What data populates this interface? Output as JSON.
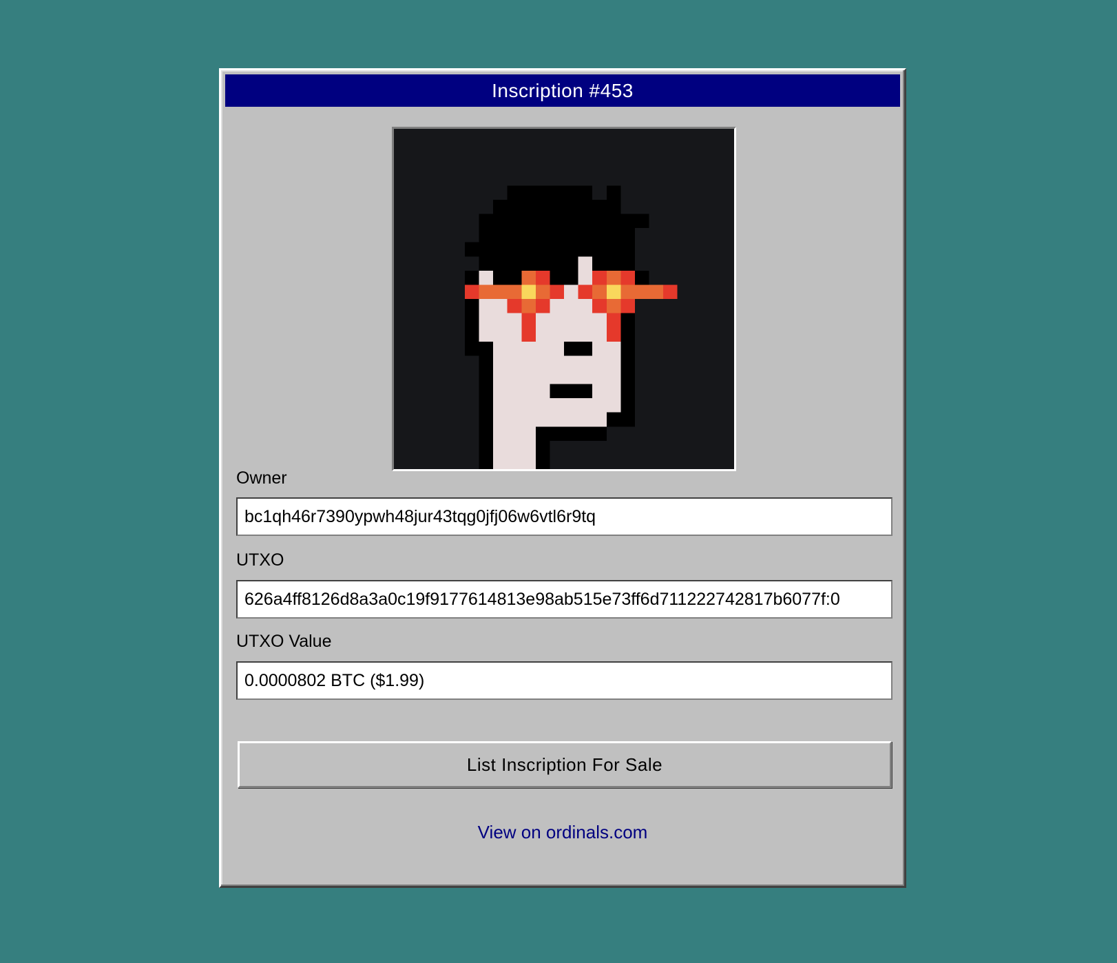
{
  "window": {
    "title": "Inscription #453"
  },
  "artwork": {
    "icon": "pixel-punk-laser-eyes-image",
    "colors": {
      "background": "#16171a",
      "hair": "#000000",
      "skin": "#e9dcdc",
      "laser_red": "#e5392b",
      "laser_orange": "#e86a35",
      "laser_core": "#f9d85c"
    }
  },
  "fields": {
    "owner": {
      "label": "Owner",
      "value": "bc1qh46r7390ypwh48jur43tqg0jfj06w6vtl6r9tq"
    },
    "utxo": {
      "label": "UTXO",
      "value": "626a4ff8126d8a3a0c19f9177614813e98ab515e73ff6d711222742817b6077f:0"
    },
    "utxo_value": {
      "label": "UTXO Value",
      "value": "0.0000802 BTC ($1.99)"
    }
  },
  "actions": {
    "list_for_sale_label": "List Inscription For Sale",
    "view_link_label": "View on ordinals.com"
  },
  "colors": {
    "desktop": "#367f7f",
    "window": "#c0c0c0",
    "title_bar": "#000080",
    "link": "#000080"
  }
}
